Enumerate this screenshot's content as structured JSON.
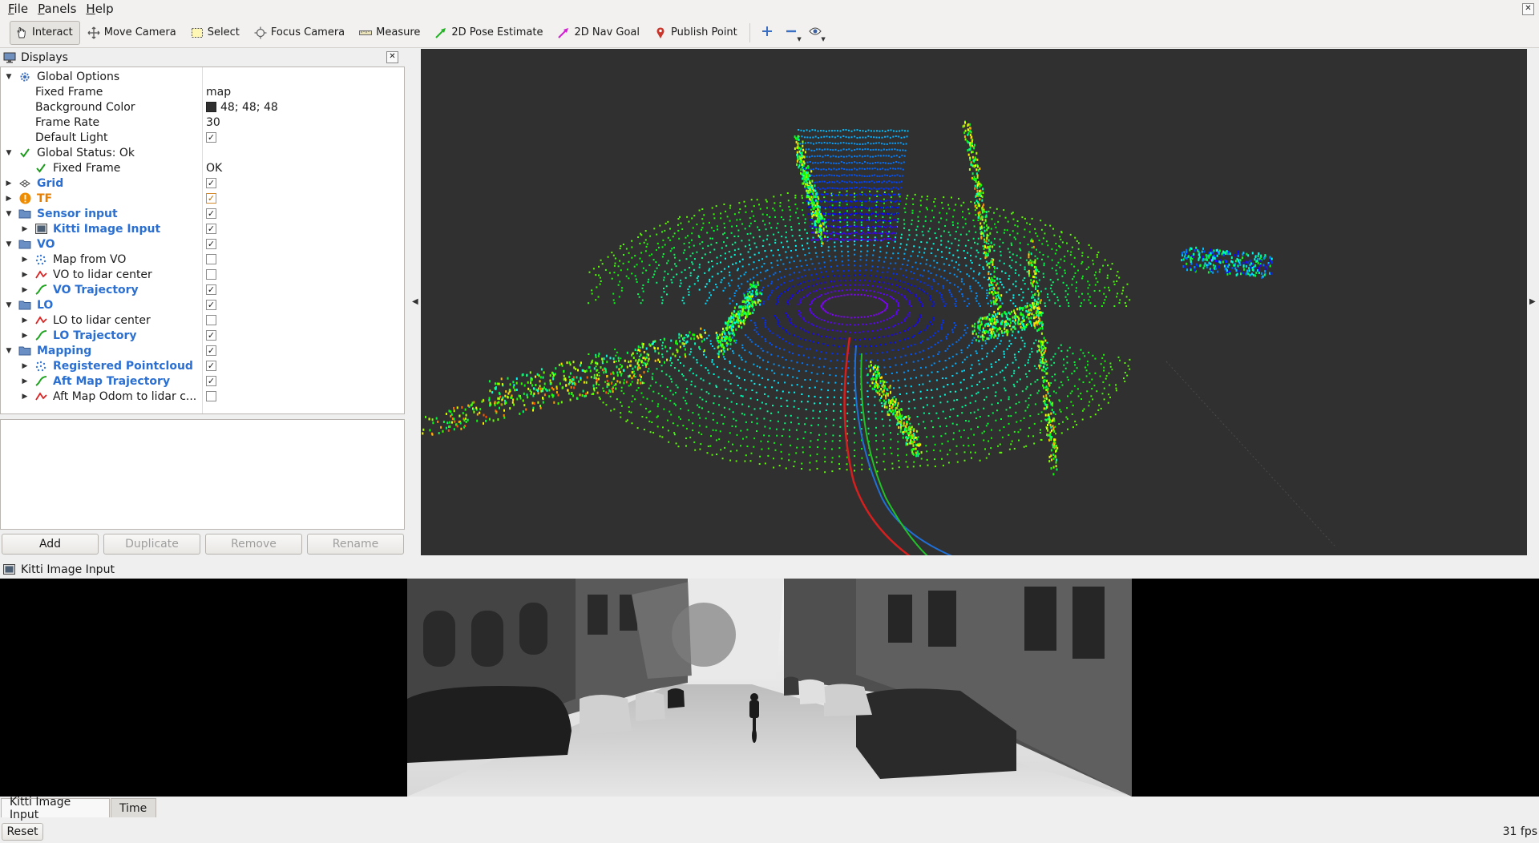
{
  "menu": [
    {
      "label": "File",
      "key": "F",
      "rest": "ile"
    },
    {
      "label": "Panels",
      "key": "P",
      "rest": "anels"
    },
    {
      "label": "Help",
      "key": "H",
      "rest": "elp"
    }
  ],
  "toolbar": {
    "interact": "Interact",
    "move_camera": "Move Camera",
    "select": "Select",
    "focus_camera": "Focus Camera",
    "measure": "Measure",
    "pose_estimate": "2D Pose Estimate",
    "nav_goal": "2D Nav Goal",
    "publish_point": "Publish Point"
  },
  "displays_panel": {
    "title": "Displays",
    "rows": [
      {
        "label": "Global Options",
        "value": ""
      },
      {
        "label": "Fixed Frame",
        "value": "map"
      },
      {
        "label": "Background Color",
        "value": "48; 48; 48"
      },
      {
        "label": "Frame Rate",
        "value": "30"
      },
      {
        "label": "Default Light",
        "value": "✓"
      },
      {
        "label": "Global Status: Ok",
        "value": ""
      },
      {
        "label": "Fixed Frame",
        "value": "OK"
      },
      {
        "label": "Grid",
        "value": "✓"
      },
      {
        "label": "TF",
        "value": "✓"
      },
      {
        "label": "Sensor input",
        "value": "✓"
      },
      {
        "label": "Kitti Image Input",
        "value": "✓"
      },
      {
        "label": "VO",
        "value": "✓"
      },
      {
        "label": "Map from VO",
        "value": ""
      },
      {
        "label": "VO to lidar center",
        "value": ""
      },
      {
        "label": "VO Trajectory",
        "value": "✓"
      },
      {
        "label": "LO",
        "value": "✓"
      },
      {
        "label": "LO to lidar center",
        "value": ""
      },
      {
        "label": "LO Trajectory",
        "value": "✓"
      },
      {
        "label": "Mapping",
        "value": "✓"
      },
      {
        "label": "Registered Pointcloud",
        "value": "✓"
      },
      {
        "label": "Aft Map Trajectory",
        "value": "✓"
      },
      {
        "label": "Aft Map Odom to lidar c...",
        "value": ""
      }
    ],
    "buttons": {
      "add": "Add",
      "duplicate": "Duplicate",
      "remove": "Remove",
      "rename": "Rename"
    }
  },
  "colors": {
    "background": "#303030",
    "blue_label": "#2a6fd1",
    "tf_orange": "#e67e00"
  },
  "image_panel": {
    "title": "Kitti Image Input"
  },
  "tabs": {
    "image": "Kitti Image Input",
    "time": "Time"
  },
  "status": {
    "reset": "Reset",
    "fps": "31 fps"
  }
}
